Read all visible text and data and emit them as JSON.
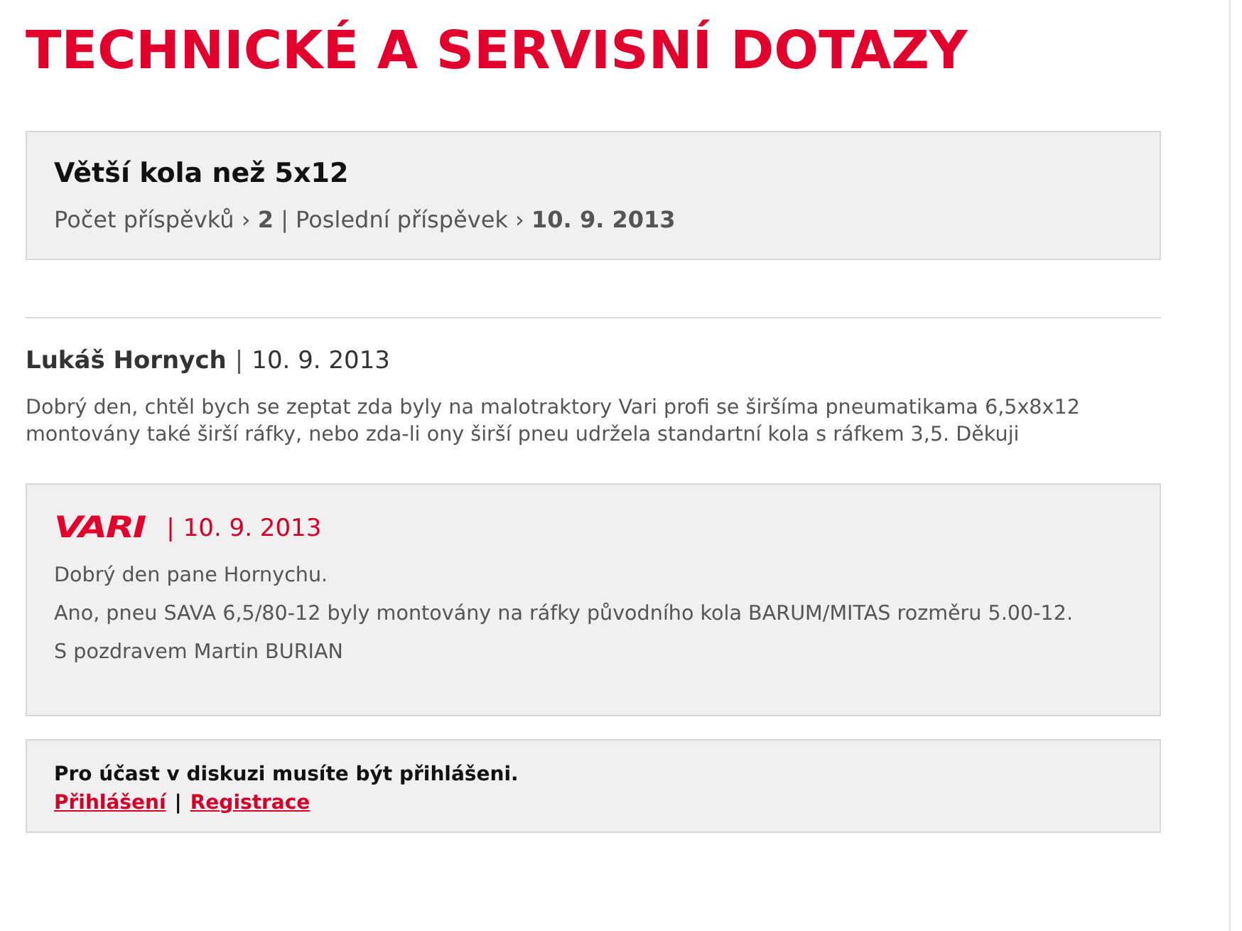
{
  "page_title": "TECHNICKÉ A SERVISNÍ DOTAZY",
  "topic": {
    "title": "Větší kola než 5x12",
    "meta": "Počet příspěvků › **2** | Poslední příspěvek › **10. 9. 2013**"
  },
  "posts": [
    {
      "kind": "question",
      "author": "Lukáš Hornych",
      "separator": "|",
      "date": "10. 9. 2013",
      "paragraphs": [
        "Dobrý den, chtěl bych se zeptat zda byly na malotraktory Vari profi se širšíma pneumatikama 6,5x8x12 montovány také širší ráfky, nebo zda-li ony širší pneu udržela standartní kola s ráfkem 3,5. Děkuji"
      ]
    },
    {
      "kind": "answer",
      "author": "VARI",
      "separator": "|",
      "date": "10. 9. 2013",
      "paragraphs": [
        "Dobrý den pane Hornychu.",
        "Ano, pneu SAVA 6,5/80-12 byly montovány na ráfky původního kola BARUM/MITAS rozměru 5.00-12.",
        "S pozdravem Martin BURIAN"
      ]
    }
  ],
  "login_notice": {
    "message": "Pro účast v diskuzi musíte být přihlášeni.",
    "links": [
      "Přihlášení",
      "Registrace"
    ],
    "separator": "|"
  }
}
